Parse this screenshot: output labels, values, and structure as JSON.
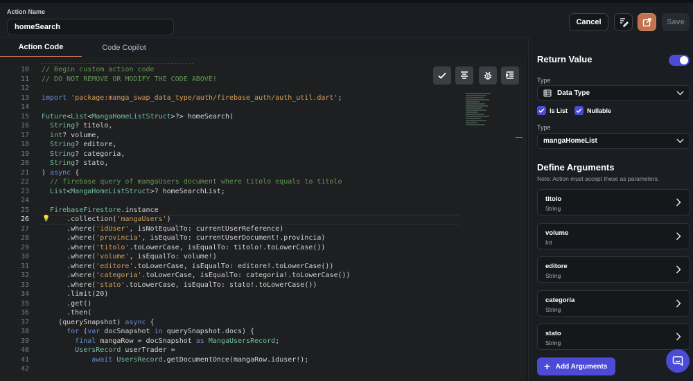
{
  "header": {
    "action_name_label": "Action Name",
    "action_name_value": "homeSearch",
    "cancel_label": "Cancel",
    "save_label": "Save",
    "icons": [
      "format-icon",
      "open-external-icon"
    ]
  },
  "tabs": [
    {
      "label": "Action Code",
      "active": true
    },
    {
      "label": "Code Copilot",
      "active": false
    }
  ],
  "editor": {
    "tool_icons": [
      "check-icon",
      "align-center-icon",
      "bug-icon",
      "indent-icon"
    ],
    "current_line": 26,
    "lines": [
      {
        "n": 10,
        "t": [
          [
            "c",
            "// Begin custom action code"
          ]
        ]
      },
      {
        "n": 11,
        "t": [
          [
            "c",
            "// DO NOT REMOVE OR MODIFY THE CODE ABOVE!"
          ]
        ]
      },
      {
        "n": 12,
        "t": []
      },
      {
        "n": 13,
        "t": [
          [
            "k",
            "import "
          ],
          [
            "s",
            "'package:manga_swap_data_type/auth/firebase_auth/auth_util.dart'"
          ],
          [
            "p",
            ";"
          ]
        ]
      },
      {
        "n": 14,
        "t": []
      },
      {
        "n": 15,
        "t": [
          [
            "y",
            "Future"
          ],
          [
            "p",
            "<"
          ],
          [
            "y",
            "List"
          ],
          [
            "p",
            "<"
          ],
          [
            "y",
            "MangaHomeListStruct"
          ],
          [
            "p",
            ">?> homeSearch("
          ]
        ]
      },
      {
        "n": 16,
        "t": [
          [
            "p",
            "  "
          ],
          [
            "y",
            "String"
          ],
          [
            "p",
            "? titolo,"
          ]
        ]
      },
      {
        "n": 17,
        "t": [
          [
            "p",
            "  "
          ],
          [
            "y",
            "int"
          ],
          [
            "p",
            "? volume,"
          ]
        ]
      },
      {
        "n": 18,
        "t": [
          [
            "p",
            "  "
          ],
          [
            "y",
            "String"
          ],
          [
            "p",
            "? editore,"
          ]
        ]
      },
      {
        "n": 19,
        "t": [
          [
            "p",
            "  "
          ],
          [
            "y",
            "String"
          ],
          [
            "p",
            "? categoria,"
          ]
        ]
      },
      {
        "n": 20,
        "t": [
          [
            "p",
            "  "
          ],
          [
            "y",
            "String"
          ],
          [
            "p",
            "? stato,"
          ]
        ]
      },
      {
        "n": 21,
        "t": [
          [
            "p",
            ") "
          ],
          [
            "k",
            "async"
          ],
          [
            "p",
            " {"
          ]
        ]
      },
      {
        "n": 22,
        "t": [
          [
            "c",
            "  // firebase query of mangaUsers document where titolo equals to titolo"
          ]
        ]
      },
      {
        "n": 23,
        "t": [
          [
            "p",
            "  "
          ],
          [
            "y",
            "List"
          ],
          [
            "p",
            "<"
          ],
          [
            "y",
            "MangaHomeListStruct"
          ],
          [
            "p",
            ">? homeSearchList;"
          ]
        ]
      },
      {
        "n": 24,
        "t": []
      },
      {
        "n": 25,
        "t": [
          [
            "p",
            "  "
          ],
          [
            "y",
            "FirebaseFirestore"
          ],
          [
            "p",
            ".instance"
          ]
        ]
      },
      {
        "n": 26,
        "t": [
          [
            "p",
            "      .collection("
          ],
          [
            "s",
            "'mangaUsers'"
          ],
          [
            "p",
            ")"
          ]
        ]
      },
      {
        "n": 27,
        "t": [
          [
            "p",
            "      .where("
          ],
          [
            "s",
            "'idUser'"
          ],
          [
            "p",
            ", isNotEqualTo: currentUserReference)"
          ]
        ]
      },
      {
        "n": 28,
        "t": [
          [
            "p",
            "      .where("
          ],
          [
            "s",
            "'provincia'"
          ],
          [
            "p",
            ", isEqualTo: currentUserDocument!.provincia)"
          ]
        ]
      },
      {
        "n": 29,
        "t": [
          [
            "p",
            "      .where("
          ],
          [
            "s",
            "'titolo'"
          ],
          [
            "p",
            ".toLowerCase, isEqualTo: titolo!.toLowerCase())"
          ]
        ]
      },
      {
        "n": 30,
        "t": [
          [
            "p",
            "      .where("
          ],
          [
            "s",
            "'volume'"
          ],
          [
            "p",
            ", isEqualTo: volume!)"
          ]
        ]
      },
      {
        "n": 31,
        "t": [
          [
            "p",
            "      .where("
          ],
          [
            "s",
            "'editore'"
          ],
          [
            "p",
            ".toLowerCase, isEqualTo: editore!.toLowerCase())"
          ]
        ]
      },
      {
        "n": 32,
        "t": [
          [
            "p",
            "      .where("
          ],
          [
            "s",
            "'categoria'"
          ],
          [
            "p",
            ".toLowerCase, isEqualTo: categoria!.toLowerCase())"
          ]
        ]
      },
      {
        "n": 33,
        "t": [
          [
            "p",
            "      .where("
          ],
          [
            "s",
            "'stato'"
          ],
          [
            "p",
            ".toLowerCase, isEqualTo: stato!.toLowerCase())"
          ]
        ]
      },
      {
        "n": 34,
        "t": [
          [
            "p",
            "      .limit(20)"
          ]
        ]
      },
      {
        "n": 35,
        "t": [
          [
            "p",
            "      .get()"
          ]
        ]
      },
      {
        "n": 36,
        "t": [
          [
            "p",
            "      .then("
          ]
        ]
      },
      {
        "n": 37,
        "t": [
          [
            "p",
            "    (querySnapshot) "
          ],
          [
            "k",
            "async"
          ],
          [
            "p",
            " {"
          ]
        ]
      },
      {
        "n": 38,
        "t": [
          [
            "p",
            "      "
          ],
          [
            "k",
            "for"
          ],
          [
            "p",
            " ("
          ],
          [
            "k",
            "var"
          ],
          [
            "p",
            " docSnapshot "
          ],
          [
            "k",
            "in"
          ],
          [
            "p",
            " querySnapshot.docs) {"
          ]
        ]
      },
      {
        "n": 39,
        "t": [
          [
            "p",
            "        "
          ],
          [
            "k",
            "final"
          ],
          [
            "p",
            " mangaRow = docSnapshot "
          ],
          [
            "k",
            "as"
          ],
          [
            "p",
            " "
          ],
          [
            "y",
            "MangaUsersRecord"
          ],
          [
            "p",
            ";"
          ]
        ]
      },
      {
        "n": 40,
        "t": [
          [
            "p",
            "        "
          ],
          [
            "y",
            "UsersRecord"
          ],
          [
            "p",
            " userTrader ="
          ]
        ]
      },
      {
        "n": 41,
        "t": [
          [
            "p",
            "            "
          ],
          [
            "k",
            "await"
          ],
          [
            "p",
            " "
          ],
          [
            "y",
            "UsersRecord"
          ],
          [
            "p",
            ".getDocumentOnce(mangaRow.iduser!);"
          ]
        ]
      },
      {
        "n": 42,
        "t": []
      }
    ]
  },
  "return_value": {
    "title": "Return Value",
    "enabled": true,
    "type_label": "Type",
    "type_value": "Data Type",
    "is_list_label": "Is List",
    "is_list_checked": true,
    "nullable_label": "Nullable",
    "nullable_checked": true,
    "type2_label": "Type",
    "type2_value": "mangaHomeList"
  },
  "arguments": {
    "title": "Define Arguments",
    "note": "Note: Action must accept these as parameters.",
    "items": [
      {
        "name": "titolo",
        "type": "String"
      },
      {
        "name": "volume",
        "type": "Int"
      },
      {
        "name": "editore",
        "type": "String"
      },
      {
        "name": "categoria",
        "type": "String"
      },
      {
        "name": "stato",
        "type": "String"
      }
    ],
    "add_label": "Add Arguments"
  },
  "colors": {
    "accent": "#c1714d",
    "primary": "#4b4bd6",
    "background": "#14181b",
    "editor_bg": "#1e1f21"
  }
}
